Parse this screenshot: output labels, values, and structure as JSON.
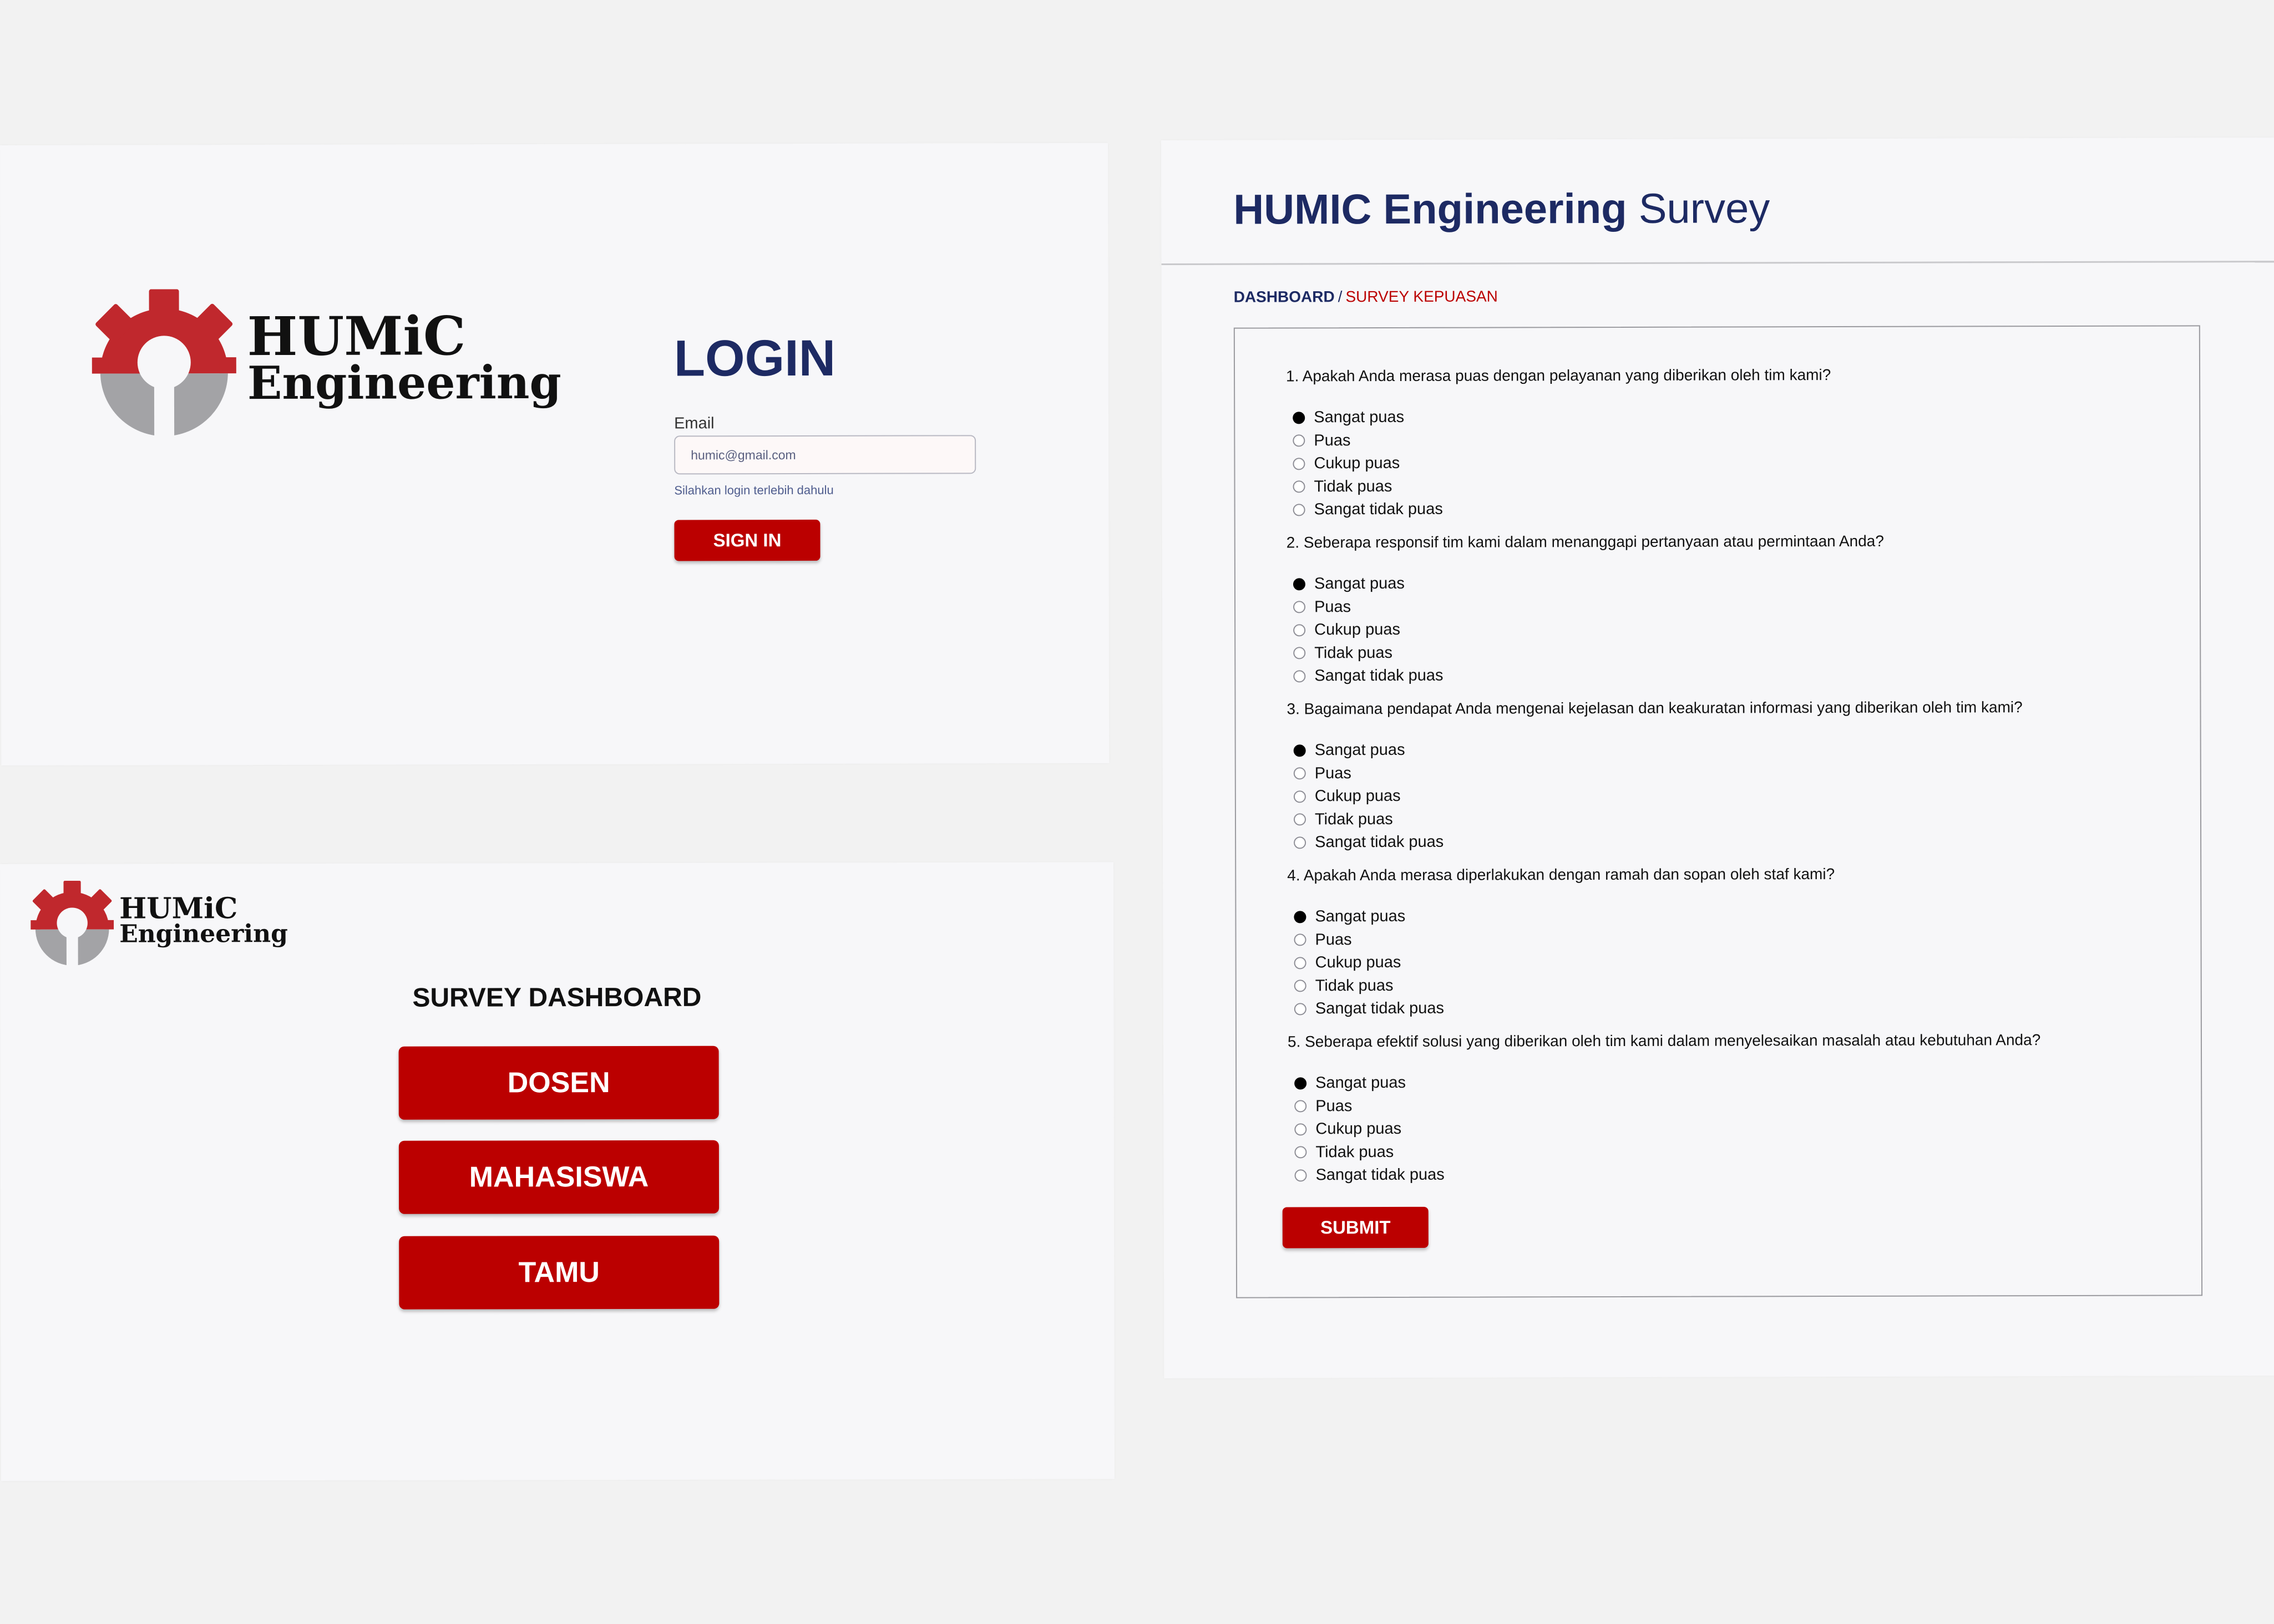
{
  "brand": {
    "logo_line1": "HUMiC",
    "logo_line2": "Engineering",
    "colors": {
      "red": "#bb0000",
      "gear_red": "#c0282d",
      "gear_gray": "#a3a3a6",
      "navy": "#1d2a63"
    }
  },
  "login": {
    "title": "LOGIN",
    "email_label": "Email",
    "email_placeholder": "humic@gmail.com",
    "hint": "Silahkan login terlebih dahulu",
    "signin_label": "SIGN IN"
  },
  "dashboard": {
    "title": "SURVEY DASHBOARD",
    "buttons": [
      "DOSEN",
      "MAHASISWA",
      "TAMU"
    ]
  },
  "survey": {
    "header_bold": "HUMIC Engineering",
    "header_light": "Survey",
    "breadcrumb": {
      "home": "DASHBOARD",
      "separator": "/",
      "current": "SURVEY KEPUASAN"
    },
    "options": [
      "Sangat puas",
      "Puas",
      "Cukup puas",
      "Tidak puas",
      "Sangat tidak puas"
    ],
    "selected_option_index": 0,
    "questions": [
      "1. Apakah Anda merasa puas dengan pelayanan yang diberikan oleh tim kami?",
      "2. Seberapa responsif tim kami dalam menanggapi pertanyaan atau permintaan Anda?",
      "3. Bagaimana pendapat Anda mengenai kejelasan dan keakuratan informasi yang diberikan oleh tim kami?",
      "4. Apakah Anda merasa diperlakukan dengan ramah dan sopan oleh staf kami?",
      "5. Seberapa efektif solusi yang diberikan oleh tim kami dalam menyelesaikan masalah atau kebutuhan Anda?"
    ],
    "submit_label": "SUBMIT"
  }
}
